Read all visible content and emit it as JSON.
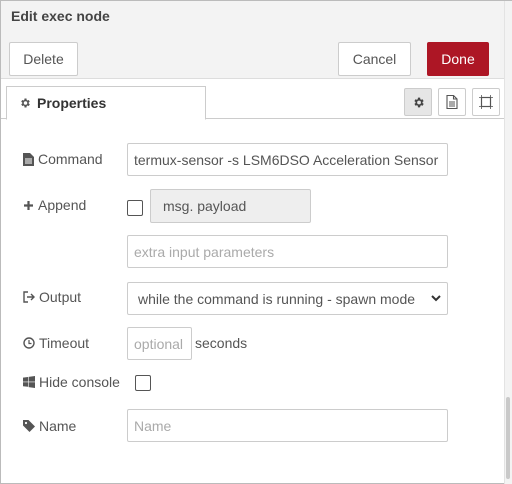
{
  "header": {
    "title": "Edit exec node",
    "delete_label": "Delete",
    "cancel_label": "Cancel",
    "done_label": "Done"
  },
  "tabs": {
    "properties_label": "Properties"
  },
  "form": {
    "command": {
      "label": "Command",
      "value": "termux-sensor -s LSM6DSO Acceleration Sensor"
    },
    "append": {
      "label": "Append",
      "checked": false,
      "payload_label": "msg. payload",
      "extra_placeholder": "extra input parameters"
    },
    "output": {
      "label": "Output",
      "selected": "while the command is running - spawn mode"
    },
    "timeout": {
      "label": "Timeout",
      "placeholder": "optional",
      "unit": "seconds"
    },
    "hide_console": {
      "label": "Hide console",
      "checked": false
    },
    "name": {
      "label": "Name",
      "placeholder": "Name"
    }
  },
  "colors": {
    "done_button": "#ad1625",
    "header_bg": "#f3f3f3"
  },
  "icons": [
    "gear-icon",
    "file-icon",
    "frame-icon",
    "file-text-icon",
    "plus-icon",
    "sign-out-icon",
    "clock-icon",
    "windows-icon",
    "tag-icon",
    "chevron-down-icon"
  ]
}
